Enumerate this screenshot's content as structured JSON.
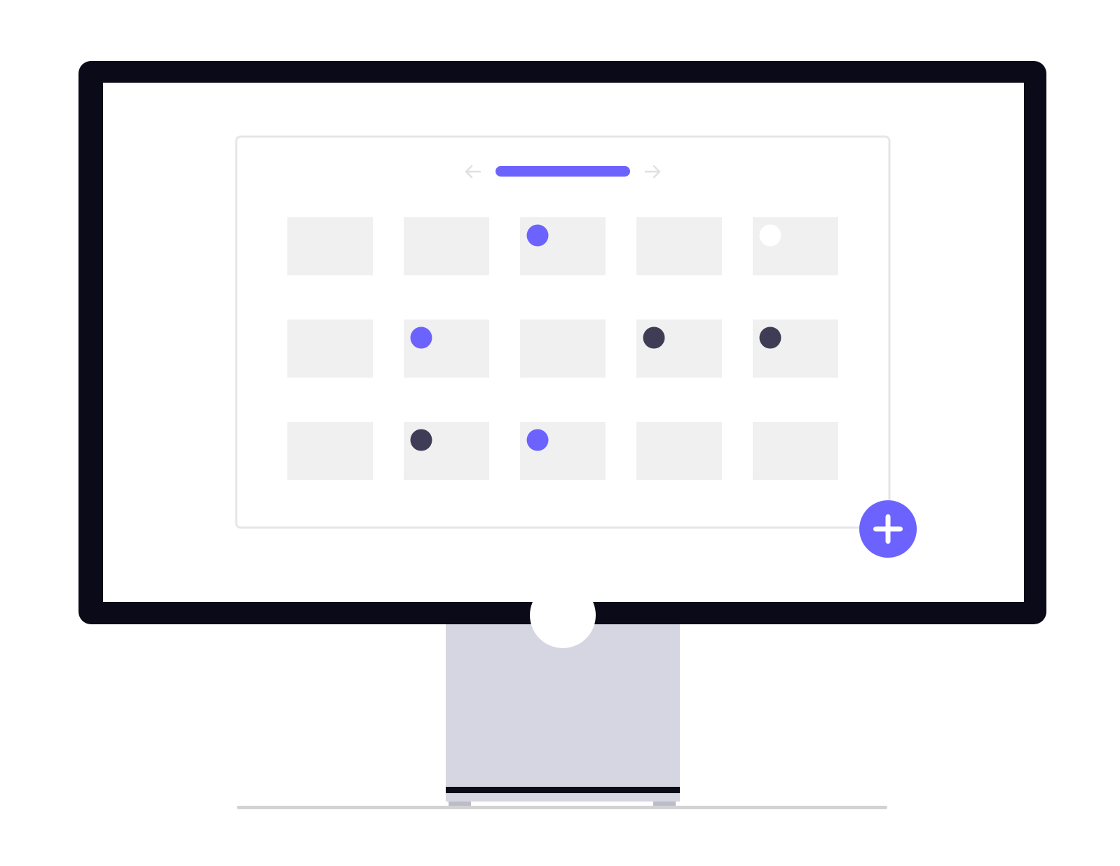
{
  "colors": {
    "bezel": "#0b0a18",
    "screen": "#ffffff",
    "stand": "#d6d6e2",
    "stand_stripe": "#0b0a18",
    "stand_feet": "#bcbcc8",
    "floor_line": "#d2d2d2",
    "panel_border": "#e6e6e6",
    "cell": "#f0f0f0",
    "accent": "#6c63ff",
    "dark_dot": "#3f3d56",
    "nav_arrow": "#e0e0e0",
    "fab_icon": "#ffffff"
  },
  "icons": {
    "previous": "arrow-left-icon",
    "next": "arrow-right-icon",
    "add": "plus-icon"
  },
  "calendar": {
    "rows": [
      [
        "none",
        "none",
        "accent",
        "none",
        "light"
      ],
      [
        "none",
        "accent",
        "none",
        "dark",
        "dark"
      ],
      [
        "none",
        "dark",
        "accent",
        "none",
        "none"
      ]
    ]
  }
}
